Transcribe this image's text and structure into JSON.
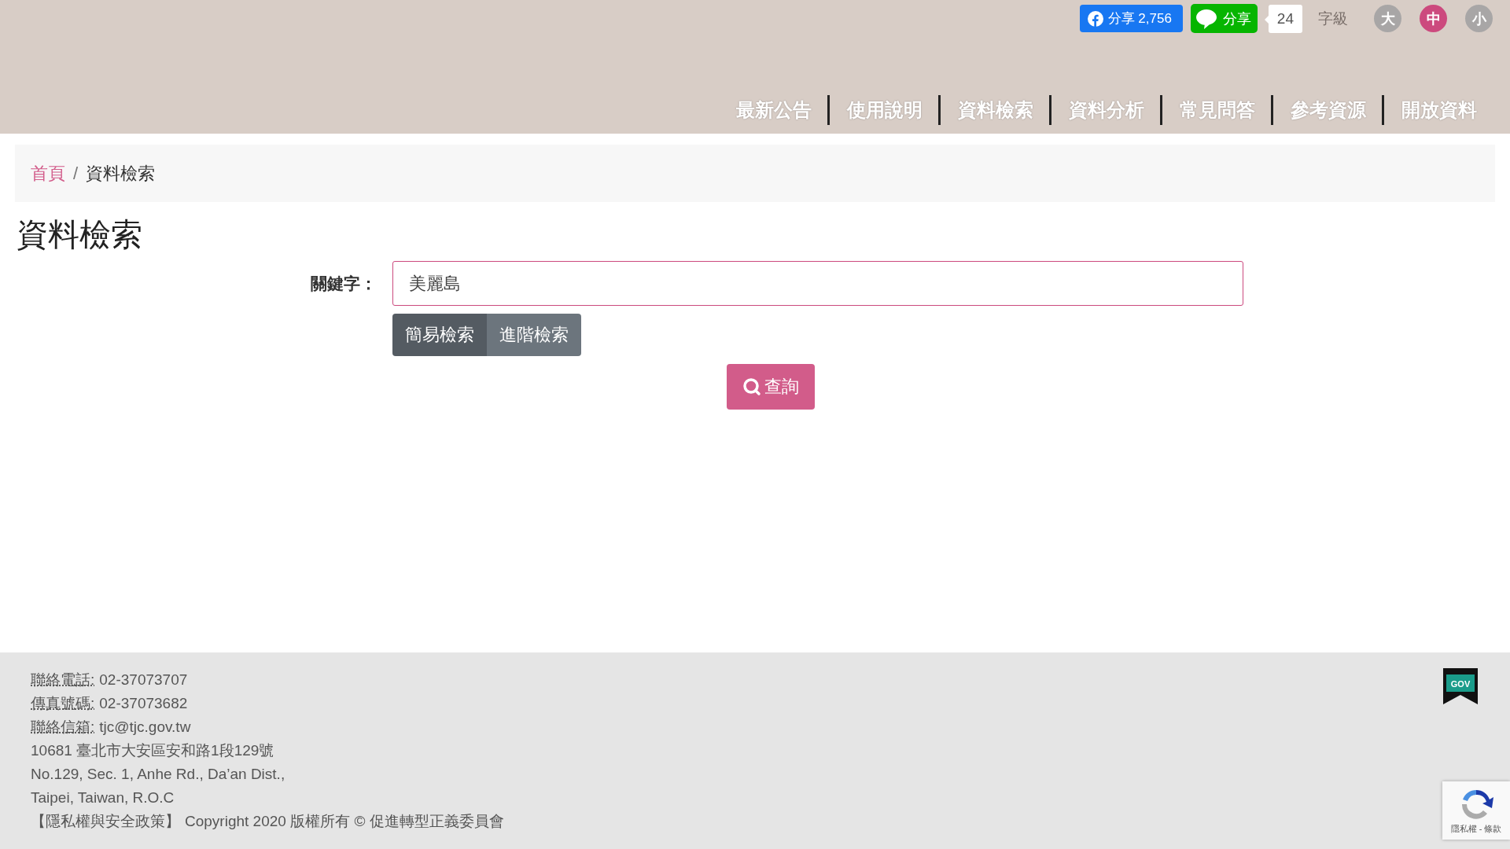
{
  "share": {
    "facebook": "分享 2,756",
    "line": "分享",
    "count": "24"
  },
  "font_size": {
    "label": "字級",
    "options": [
      {
        "label": "大",
        "selected": false
      },
      {
        "label": "中",
        "selected": true
      },
      {
        "label": "小",
        "selected": false
      }
    ]
  },
  "nav": [
    "最新公告",
    "使用說明",
    "資料檢索",
    "資料分析",
    "常見問答",
    "參考資源",
    "開放資料"
  ],
  "breadcrumb": [
    {
      "label": "首頁",
      "kind": "link"
    },
    {
      "label": "資料檢索",
      "kind": "current"
    }
  ],
  "breadcrumb_separator": "/",
  "title": "資料檢索",
  "search": {
    "label": "關鍵字：",
    "value": "美麗島",
    "modes": [
      {
        "label": "簡易檢索",
        "selected": true
      },
      {
        "label": "進階檢索",
        "selected": false
      }
    ],
    "submit": "查詢"
  },
  "footer": {
    "lines": [
      {
        "kind": "abbr",
        "term": "聯絡電話:",
        "text": "02-37073707"
      },
      {
        "kind": "abbr",
        "term": "傳真號碼:",
        "text": "02-37073682"
      },
      {
        "kind": "abbr",
        "term": "聯絡信箱:",
        "text": "tjc@tjc.gov.tw"
      },
      {
        "kind": "plain",
        "text": "10681 臺北市大安區安和路1段129號"
      },
      {
        "kind": "plain",
        "text": "No.129, Sec. 1, Anhe Rd., Da’an Dist.,"
      },
      {
        "kind": "plain",
        "text": "Taipei, Taiwan, R.O.C"
      }
    ],
    "policy": "【隱私權與安全政策】",
    "copyright": "Copyright 2020 版權所有 © 促進轉型正義委員會",
    "gov_badge": "GOV",
    "recaptcha": "隱私權 - 條款"
  }
}
